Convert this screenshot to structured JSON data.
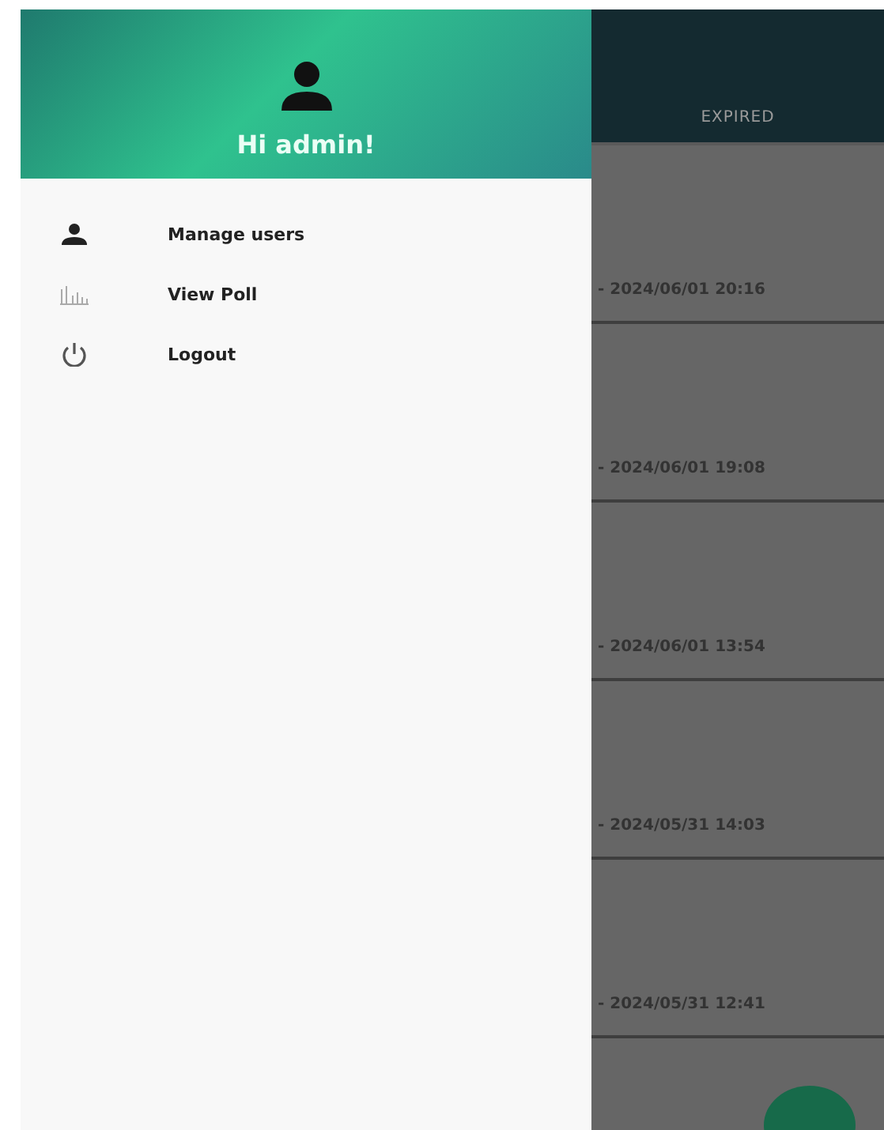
{
  "drawer": {
    "greeting": "Hi admin!",
    "items": [
      {
        "kind": "users",
        "label": "Manage users"
      },
      {
        "kind": "poll",
        "label": "View Poll"
      },
      {
        "kind": "logout",
        "label": "Logout"
      }
    ]
  },
  "tabs": [
    {
      "label": "EXPIRED"
    }
  ],
  "polls": [
    {
      "time": "- 2024/06/01 20:16"
    },
    {
      "time": "- 2024/06/01 19:08"
    },
    {
      "time": "- 2024/06/01 13:54"
    },
    {
      "time": "- 2024/05/31 14:03"
    },
    {
      "time": "- 2024/05/31 12:41"
    }
  ]
}
